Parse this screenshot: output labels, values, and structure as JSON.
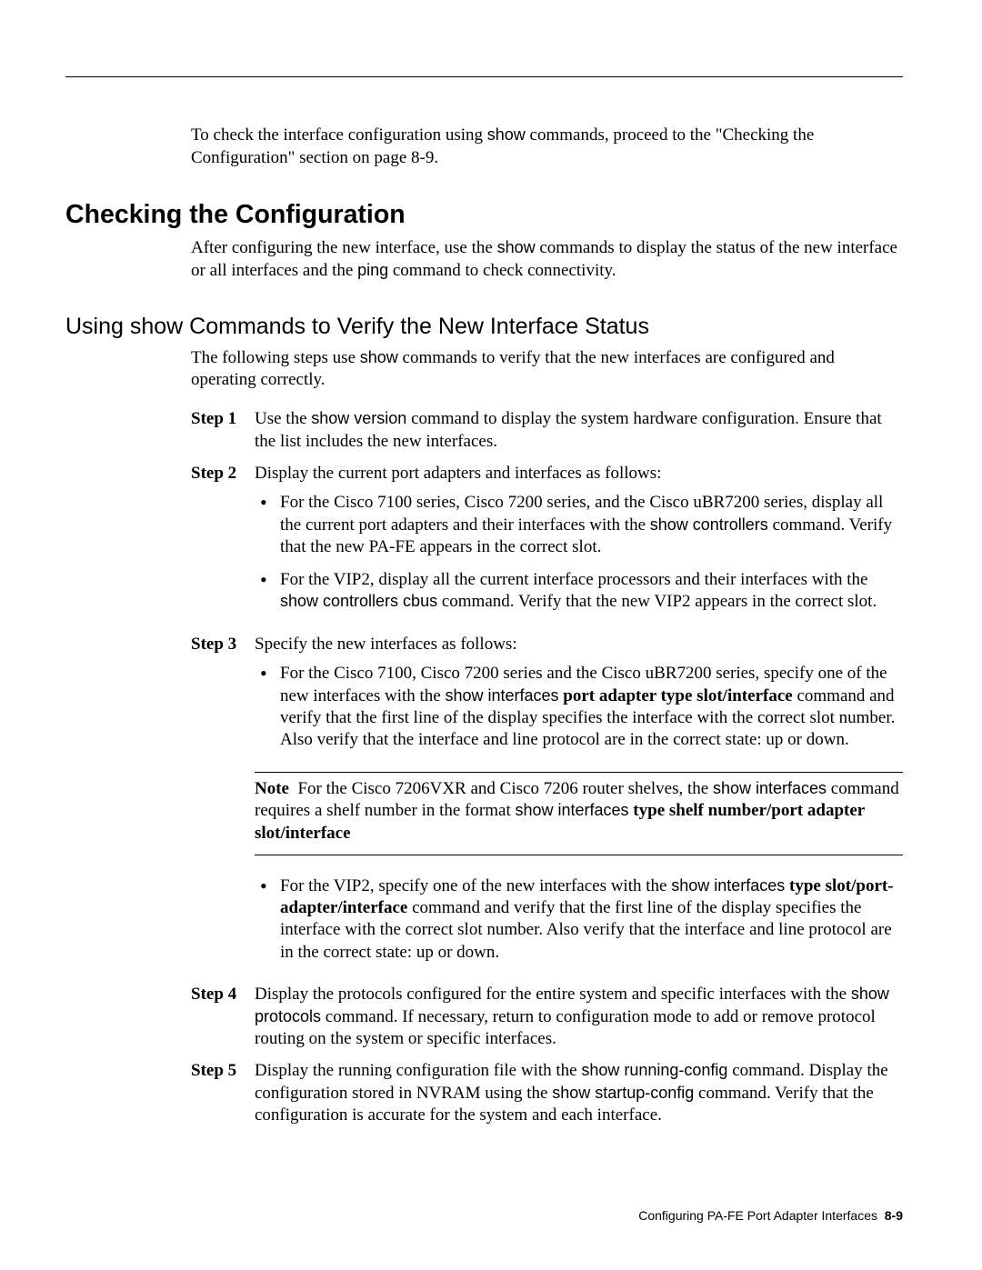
{
  "intro": {
    "p1a": "To check the interface configuration using ",
    "cmd1": "show",
    "p1b": " commands, proceed to the \"Checking the Configuration\" section on page 8-9."
  },
  "h1": "Checking the Configuration",
  "after_h1": {
    "a": "After configuring the new interface, use the ",
    "cmd_show": "show",
    "b": " commands to display the status of the new interface or all interfaces and the ",
    "cmd_ping": "ping",
    "c": " command to check connectivity."
  },
  "h2": "Using show Commands to Verify the New Interface Status",
  "after_h2": {
    "a": "The following steps use ",
    "cmd_show": "show",
    "b": " commands to verify that the new interfaces are configured and operating correctly."
  },
  "steps": {
    "s1_label": "Step 1",
    "s1": {
      "a": "Use the ",
      "cmd": "show version",
      "b": " command to display the system hardware configuration. Ensure that the list includes the new interfaces."
    },
    "s2_label": "Step 2",
    "s2_text": "Display the current port adapters and interfaces as follows:",
    "s2_b1": {
      "a": "For the Cisco 7100 series, Cisco 7200 series, and the Cisco uBR7200 series, display all the current port adapters and their interfaces with the ",
      "cmd": "show controllers",
      "b": " command. Verify that the new PA-FE appears in the correct slot."
    },
    "s2_b2": {
      "a": "For the VIP2, display all the current interface processors and their interfaces with the ",
      "cmd": "show controllers cbus",
      "b": " command. Verify that the new VIP2 appears in the correct slot."
    },
    "s3_label": "Step 3",
    "s3_text": "Specify the new interfaces as follows:",
    "s3_b1": {
      "a": "For the Cisco 7100, Cisco 7200 series and the Cisco uBR7200 series, specify one of the new interfaces with the ",
      "cmd": "show interfaces",
      "arg": " port adapter type slot/interface",
      "b": " command and verify that the first line of the display specifies the interface with the correct slot number. Also verify that the interface and line protocol are in the correct state: up or down."
    },
    "note": {
      "label": "Note",
      "a": "For the Cisco 7206VXR and Cisco 7206 router shelves, the ",
      "cmd1": "show interfaces",
      "b": " command requires a shelf number in the format ",
      "cmd2": "show interfaces",
      "arg": " type shelf number/port adapter slot/interface"
    },
    "s3_b2": {
      "a": "For the VIP2, specify one of the new interfaces with the ",
      "cmd": "show interfaces",
      "arg": " type slot/port-adapter/interface",
      "b": " command and verify that the first line of the display specifies the interface with the correct slot number. Also verify that the interface and line protocol are in the correct state: up or down."
    },
    "s4_label": "Step 4",
    "s4": {
      "a": "Display the protocols configured for the entire system and specific interfaces with the ",
      "cmd": "show protocols",
      "b": " command. If necessary, return to configuration mode to add or remove protocol routing on the system or specific interfaces."
    },
    "s5_label": "Step 5",
    "s5": {
      "a": "Display the running configuration file with the ",
      "cmd1": "show running-conﬁg",
      "b": " command. Display the configuration stored in NVRAM using the ",
      "cmd2": "show startup-conﬁg",
      "c": " command. Verify that the configuration is accurate for the system and each interface."
    }
  },
  "footer": {
    "title": "Configuring PA-FE Port Adapter Interfaces",
    "page": "8-9"
  }
}
